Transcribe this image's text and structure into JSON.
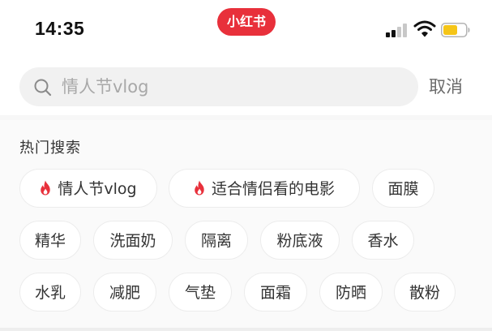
{
  "status_bar": {
    "time": "14:35",
    "app_logo": "小红书",
    "signal_icon": "cellular-signal-icon",
    "wifi_icon": "wifi-icon",
    "battery_icon": "battery-icon",
    "battery_color": "#f5c518"
  },
  "search": {
    "query": "情人节vlog",
    "icon": "search-icon",
    "cancel_label": "取消"
  },
  "hot_search": {
    "title": "热门搜索",
    "hot_icon": "fire-icon",
    "hot_color": "#e8303b",
    "items": [
      {
        "label": "情人节vlog",
        "hot": true
      },
      {
        "label": "适合情侣看的电影",
        "hot": true
      },
      {
        "label": "面膜",
        "hot": false
      },
      {
        "label": "精华",
        "hot": false
      },
      {
        "label": "洗面奶",
        "hot": false
      },
      {
        "label": "隔离",
        "hot": false
      },
      {
        "label": "粉底液",
        "hot": false
      },
      {
        "label": "香水",
        "hot": false
      },
      {
        "label": "水乳",
        "hot": false
      },
      {
        "label": "减肥",
        "hot": false
      },
      {
        "label": "气垫",
        "hot": false
      },
      {
        "label": "面霜",
        "hot": false
      },
      {
        "label": "防晒",
        "hot": false
      },
      {
        "label": "散粉",
        "hot": false
      }
    ]
  }
}
